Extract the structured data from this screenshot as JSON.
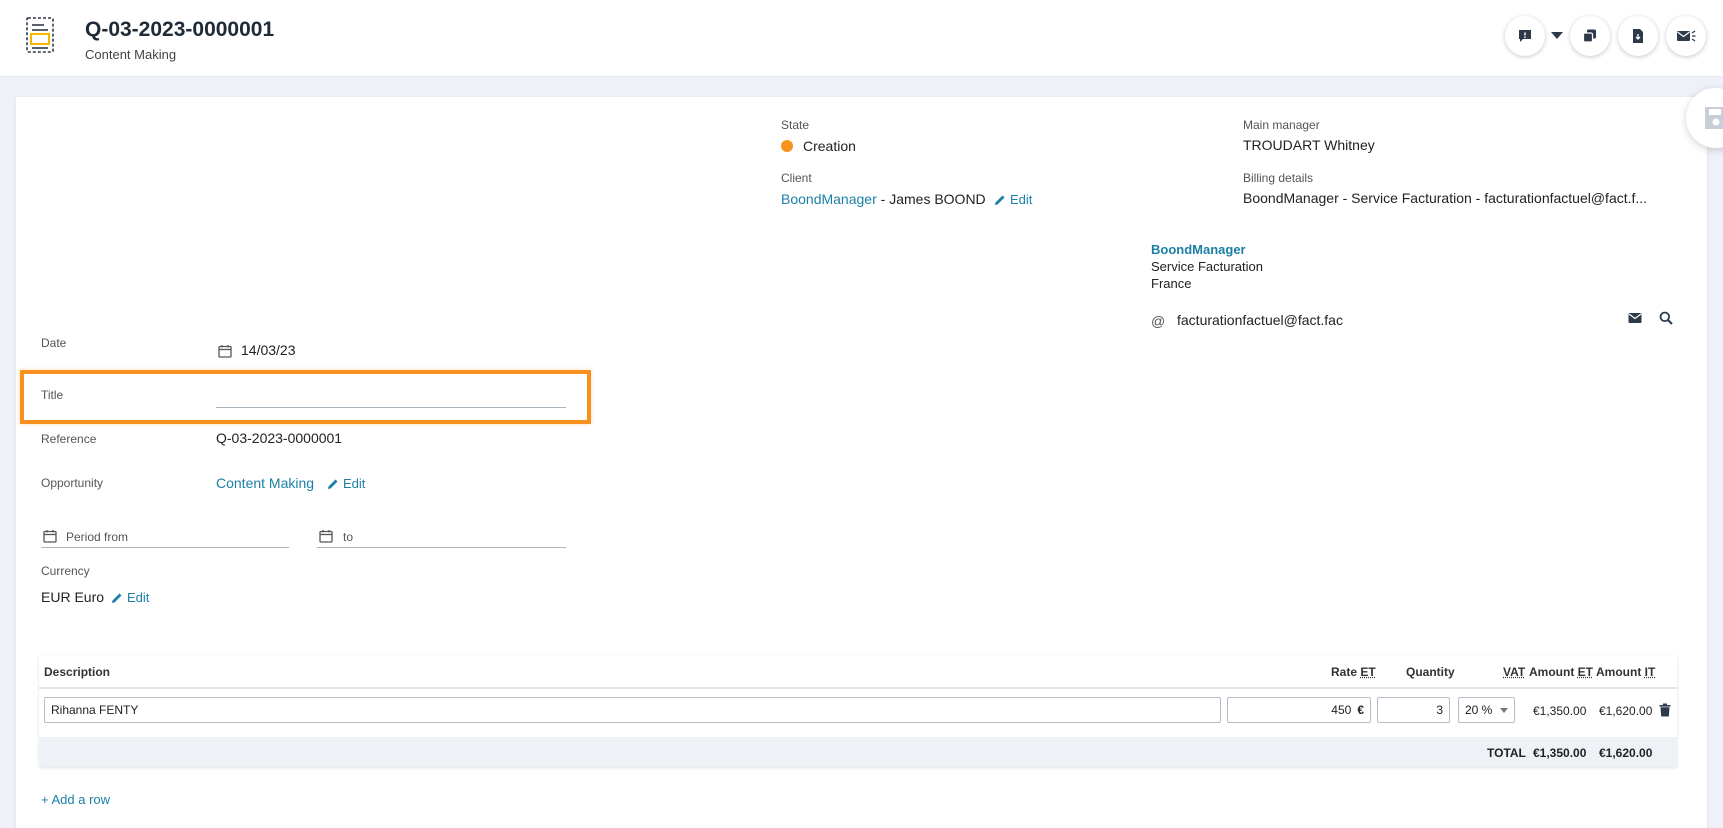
{
  "header": {
    "title": "Q-03-2023-0000001",
    "subtitle": "Content Making",
    "actions": [
      "comment-icon",
      "copy-icon",
      "pdf-icon",
      "email-icon"
    ]
  },
  "status": {
    "state_label": "State",
    "state_value": "Creation",
    "state_color": "#f7941d",
    "client_label": "Client",
    "client_company": "BoondManager",
    "client_separator": " - ",
    "client_contact": "James BOOND",
    "client_edit": "Edit",
    "manager_label": "Main manager",
    "manager_value": "TROUDART Whitney",
    "billing_label": "Billing details",
    "billing_value": "BoondManager - Service Facturation - facturationfactuel@fact.f..."
  },
  "billing_address": {
    "company": "BoondManager",
    "service": "Service Facturation",
    "country": "France",
    "email": "facturationfactuel@fact.fac"
  },
  "form": {
    "date_label": "Date",
    "date_value": "14/03/23",
    "title_label": "Title",
    "title_value": "",
    "reference_label": "Reference",
    "reference_value": "Q-03-2023-0000001",
    "opportunity_label": "Opportunity",
    "opportunity_value": "Content Making",
    "opportunity_edit": "Edit",
    "period_from_placeholder": "Period from",
    "period_to_placeholder": "to",
    "currency_label": "Currency",
    "currency_value": "EUR Euro",
    "currency_edit": "Edit"
  },
  "table": {
    "headers": {
      "description": "Description",
      "rate": "Rate",
      "et": "ET",
      "quantity": "Quantity",
      "vat": "VAT",
      "amount": "Amount",
      "it": "IT"
    },
    "rows": [
      {
        "description": "Rihanna FENTY",
        "rate": "450",
        "currency_symbol": "€",
        "quantity": "3",
        "vat": "20 %",
        "amount_et": "€1,350.00",
        "amount_it": "€1,620.00"
      }
    ],
    "total_label": "TOTAL",
    "total_et": "€1,350.00",
    "total_it": "€1,620.00",
    "add_row": "+ Add a row"
  },
  "colors": {
    "accent": "#1c7fa6",
    "highlight": "#f7901e",
    "state": "#f7941d"
  }
}
